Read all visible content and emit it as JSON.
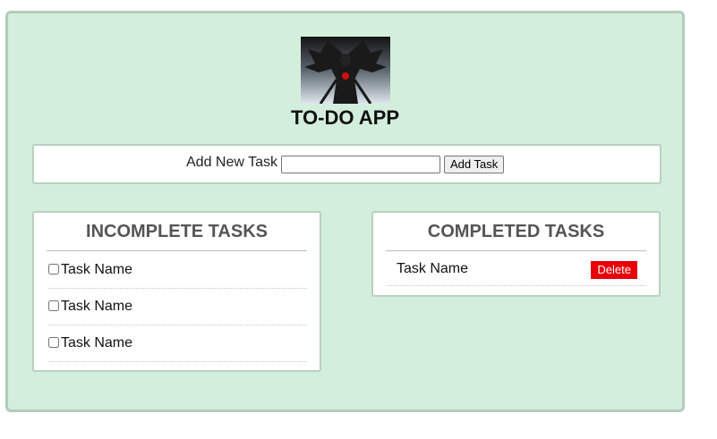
{
  "app": {
    "title": "TO-DO APP",
    "logo_icon": "winged-demon-logo"
  },
  "add_task": {
    "label": "Add New Task",
    "input_value": "",
    "button_label": "Add Task"
  },
  "incomplete": {
    "heading": "INCOMPLETE TASKS",
    "tasks": [
      {
        "name": "Task Name",
        "checked": false
      },
      {
        "name": "Task Name",
        "checked": false
      },
      {
        "name": "Task Name",
        "checked": false
      }
    ]
  },
  "completed": {
    "heading": "COMPLETED TASKS",
    "tasks": [
      {
        "name": "Task Name",
        "delete_label": "Delete"
      }
    ]
  },
  "colors": {
    "app_background": "#d4eede",
    "app_border": "#b3ccbc",
    "delete_button": "#e8000b",
    "heading_text": "#555555"
  }
}
